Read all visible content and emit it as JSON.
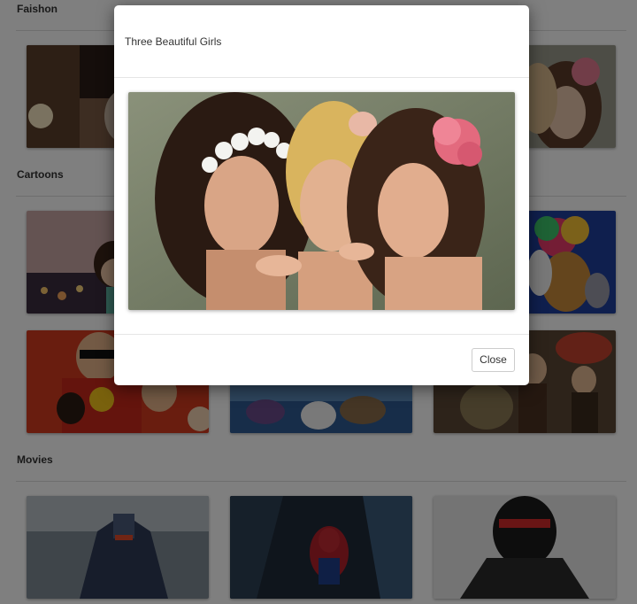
{
  "sections": {
    "fashion": {
      "title": "Faishon"
    },
    "cartoons": {
      "title": "Cartoons"
    },
    "movies": {
      "title": "Movies"
    }
  },
  "modal": {
    "title": "Three Beautiful Girls",
    "close_label": "Close"
  },
  "thumbnails": {
    "fashion": [
      "fashion-photo-1",
      "fashion-photo-2",
      "fashion-photo-3"
    ],
    "cartoons_row1": [
      "vanellope-cartoon",
      "cartoon-2",
      "madagascar-cartoon"
    ],
    "cartoons_row2": [
      "incredibles-cartoon",
      "frozen-cartoon",
      "how-to-train-your-dragon-cartoon"
    ],
    "movies": [
      "transformers-movie",
      "spiderman-movie",
      "robocop-movie"
    ]
  },
  "colors": {
    "backdrop": "#000000",
    "rule": "#dcdcdc",
    "modal_bg": "#ffffff"
  }
}
